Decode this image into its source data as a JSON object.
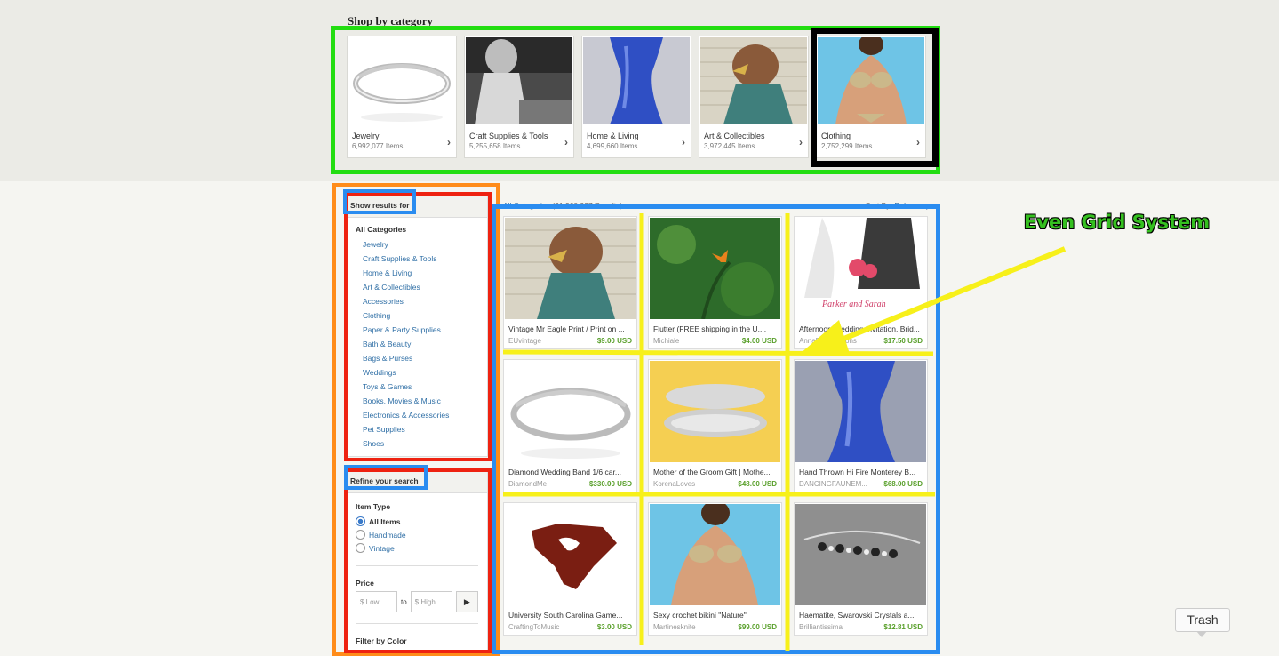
{
  "page": {
    "title": "Shop by category"
  },
  "categories": [
    {
      "name": "Jewelry",
      "count": "6,992,077 Items",
      "icon": "ring-photo"
    },
    {
      "name": "Craft Supplies & Tools",
      "count": "5,255,658 Items",
      "icon": "child-photo"
    },
    {
      "name": "Home & Living",
      "count": "4,699,660 Items",
      "icon": "vase-photo"
    },
    {
      "name": "Art & Collectibles",
      "count": "3,972,445 Items",
      "icon": "eagle-print-photo"
    },
    {
      "name": "Clothing",
      "count": "2,752,299 Items",
      "icon": "bikini-photo"
    }
  ],
  "sidebar": {
    "show_results_label": "Show results for",
    "all_categories": "All Categories",
    "items": [
      "Jewelry",
      "Craft Supplies & Tools",
      "Home & Living",
      "Art & Collectibles",
      "Accessories",
      "Clothing",
      "Paper & Party Supplies",
      "Bath & Beauty",
      "Bags & Purses",
      "Weddings",
      "Toys & Games",
      "Books, Movies & Music",
      "Electronics & Accessories",
      "Pet Supplies",
      "Shoes"
    ],
    "refine_label": "Refine your search",
    "item_type_label": "Item Type",
    "item_types": [
      "All Items",
      "Handmade",
      "Vintage"
    ],
    "price_label": "Price",
    "price_low_placeholder": "$  Low",
    "price_high_placeholder": "$  High",
    "price_to": "to",
    "price_go": "▶",
    "filter_color_label": "Filter by Color"
  },
  "results": {
    "category_link": "All Categories",
    "count_text": "(31,960,937 Results)",
    "sort_label": "Sort By:",
    "sort_value": "Relevancy"
  },
  "items": [
    {
      "title": "Vintage Mr Eagle Print / Print on ...",
      "shop": "EUvintage",
      "price": "$9.00 USD"
    },
    {
      "title": "Flutter (FREE shipping in the U....",
      "shop": "Michiale",
      "price": "$4.00 USD"
    },
    {
      "title": "Afternoon Wedding Invitation, Brid...",
      "shop": "AnnaDesignations",
      "price": "$17.50 USD"
    },
    {
      "title": "Diamond Wedding Band 1/6 car...",
      "shop": "DiamondMe",
      "price": "$330.00 USD"
    },
    {
      "title": "Mother of the Groom Gift | Mothe...",
      "shop": "KorenaLoves",
      "price": "$48.00 USD"
    },
    {
      "title": "Hand Thrown Hi Fire Monterey B...",
      "shop": "DANCINGFAUNEM...",
      "price": "$68.00 USD"
    },
    {
      "title": "University South Carolina Game...",
      "shop": "CraftingToMusic",
      "price": "$3.00 USD"
    },
    {
      "title": "Sexy crochet bikini \"Nature\"",
      "shop": "Martinesknite",
      "price": "$99.00 USD"
    },
    {
      "title": "Haematite, Swarovski Crystals a...",
      "shop": "Brilliantissima",
      "price": "$12.81 USD"
    }
  ],
  "annotation": {
    "label": "Even Grid System"
  },
  "dock": {
    "trash_label": "Trash"
  },
  "colors": {
    "green": "#22dd11",
    "black": "#000000",
    "orange": "#ff8c1a",
    "red": "#ee2211",
    "blue": "#2a8cf0",
    "yellow": "#f7f01a",
    "link": "#2e6ea5",
    "price": "#5aa02c"
  }
}
